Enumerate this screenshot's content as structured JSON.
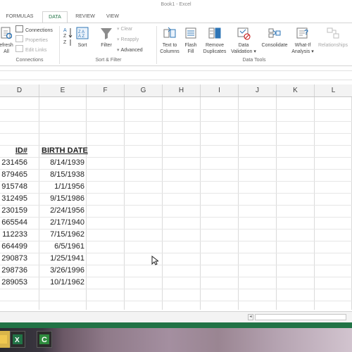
{
  "window": {
    "title": "Book1 - Excel"
  },
  "tabs": [
    {
      "label": "FORMULAS",
      "active": false
    },
    {
      "label": "DATA",
      "active": true
    },
    {
      "label": "REVIEW",
      "active": false
    },
    {
      "label": "VIEW",
      "active": false
    }
  ],
  "ribbon": {
    "connections_group": {
      "label": "Connections",
      "refresh_line1": "efresh",
      "refresh_line2": "All",
      "connections": "Connections",
      "properties": "Properties",
      "edit_links": "Edit Links"
    },
    "sort_filter_group": {
      "label": "Sort & Filter",
      "sort": "Sort",
      "filter": "Filter",
      "clear": "Clear",
      "reapply": "Reapply",
      "advanced": "Advanced"
    },
    "data_tools_group": {
      "label": "Data Tools",
      "text_to_columns_line1": "Text to",
      "text_to_columns_line2": "Columns",
      "flash_fill_line1": "Flash",
      "flash_fill_line2": "Fill",
      "remove_duplicates_line1": "Remove",
      "remove_duplicates_line2": "Duplicates",
      "data_validation_line1": "Data",
      "data_validation_line2": "Validation",
      "consolidate": "Consolidate",
      "what_if_line1": "What-If",
      "what_if_line2": "Analysis",
      "relationships": "Relationships"
    }
  },
  "columns": [
    "D",
    "E",
    "F",
    "G",
    "H",
    "I",
    "J",
    "K",
    "L"
  ],
  "table": {
    "headers": {
      "id": "ID#",
      "birth_date": "BIRTH DATE"
    },
    "rows": [
      {
        "id": "231456",
        "birth_date": "8/14/1939"
      },
      {
        "id": "879465",
        "birth_date": "8/15/1938"
      },
      {
        "id": "915748",
        "birth_date": "1/1/1956"
      },
      {
        "id": "312495",
        "birth_date": "9/15/1986"
      },
      {
        "id": "230159",
        "birth_date": "2/24/1956"
      },
      {
        "id": "665544",
        "birth_date": "2/17/1940"
      },
      {
        "id": "112233",
        "birth_date": "7/15/1962"
      },
      {
        "id": "664499",
        "birth_date": "6/5/1961"
      },
      {
        "id": "290873",
        "birth_date": "1/25/1941"
      },
      {
        "id": "298736",
        "birth_date": "3/26/1996"
      },
      {
        "id": "289053",
        "birth_date": "10/1/1962"
      }
    ]
  },
  "colors": {
    "accent": "#217346",
    "grid_line": "#dadada",
    "header_bg": "#f3f3f3"
  },
  "taskbar": {
    "icons": [
      "explorer-icon",
      "excel-icon",
      "camtasia-icon"
    ]
  }
}
